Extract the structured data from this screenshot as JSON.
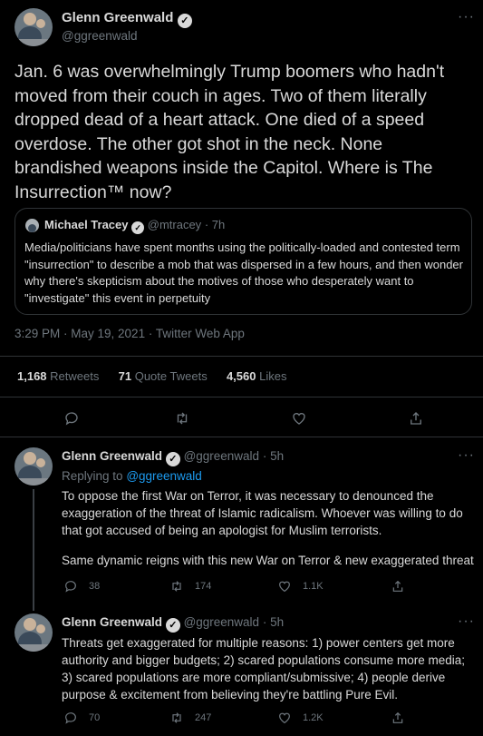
{
  "main_tweet": {
    "author_name": "Glenn Greenwald",
    "author_handle": "@ggreenwald",
    "text": "Jan. 6 was overwhelmingly Trump boomers who hadn't moved from their couch in ages. Two of them literally dropped dead of a heart attack. One died of a speed overdose. The other got shot in the neck. None brandished weapons inside the Capitol. Where is The Insurrection™ now?",
    "quote": {
      "author_name": "Michael Tracey",
      "author_handle": "@mtracey",
      "time": "· 7h",
      "text": "Media/politicians have spent months using the politically-loaded and contested term \"insurrection\" to describe a mob that was dispersed in a few hours, and then wonder why there's skepticism about the motives of those who desperately want to \"investigate\" this event in perpetuity"
    },
    "timestamp": "3:29 PM · May 19, 2021 · Twitter Web App",
    "stats": {
      "retweets_count": "1,168",
      "retweets_label": "Retweets",
      "quotes_count": "71",
      "quotes_label": "Quote Tweets",
      "likes_count": "4,560",
      "likes_label": "Likes"
    }
  },
  "replies": [
    {
      "author_name": "Glenn Greenwald",
      "author_handle": "@ggreenwald",
      "time": "· 5h",
      "replying_prefix": "Replying to",
      "replying_to": "@ggreenwald",
      "paragraph1": "To oppose the first War on Terror, it was necessary to denounced the exaggeration of the threat of Islamic radicalism. Whoever was willing to do that got accused of being an apologist for Muslim terrorists.",
      "paragraph2": "Same dynamic reigns with this new War on Terror & new exaggerated threat",
      "reply_count": "38",
      "retweet_count": "174",
      "like_count": "1.1K"
    },
    {
      "author_name": "Glenn Greenwald",
      "author_handle": "@ggreenwald",
      "time": "· 5h",
      "paragraph1": "Threats get exaggerated for multiple reasons: 1) power centers get more authority and bigger budgets; 2) scared populations consume more media; 3) scared populations are more compliant/submissive; 4) people derive purpose & excitement from believing they're battling Pure Evil.",
      "reply_count": "70",
      "retweet_count": "247",
      "like_count": "1.2K"
    }
  ],
  "icons": {
    "more": "more-icon",
    "verified": "verified-badge-icon",
    "reply": "reply-icon",
    "retweet": "retweet-icon",
    "like": "like-icon",
    "share": "share-icon"
  },
  "colors": {
    "background": "#000000",
    "text": "#d9d9d9",
    "muted": "#6e767d",
    "link": "#1d9bf0",
    "border": "#2f3336"
  }
}
